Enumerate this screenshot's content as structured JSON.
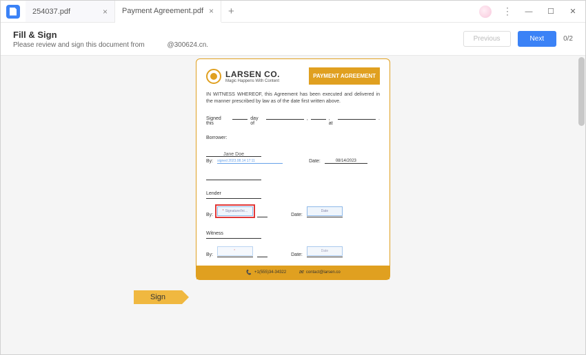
{
  "tabs": [
    {
      "label": "254037.pdf"
    },
    {
      "label": "Payment Agreement.pdf"
    }
  ],
  "subheader": {
    "title": "Fill & Sign",
    "instruction": "Please review and sign this document from",
    "sender": "@300624.cn.",
    "prev_label": "Previous",
    "next_label": "Next",
    "page_counter": "0/2"
  },
  "pointer": {
    "label": "Sign"
  },
  "document": {
    "company_name": "LARSEN CO.",
    "company_tagline": "Magic Happens With Content",
    "badge": "PAYMENT AGREEMENT",
    "witness": "IN WITNESS WHEREOF, this Agreement has been executed and delivered in the manner prescribed by law as of the date first written above.",
    "signed_this": "Signed this",
    "day_of": "day of",
    "at": ", at",
    "borrower_label": "Borrower:",
    "borrower_name": "Jane Doe",
    "borrower_sig": "signed 2023.08.14 17:11",
    "by_label": "By:",
    "date_label": "Date:",
    "date_value": "08/14/2023",
    "lender_label": "Lender",
    "sig_placeholder": "Signature/Ini…",
    "date_placeholder": "Date",
    "witness_label": "Witness",
    "phone": "+1(555)34-34322",
    "email": "contact@larsen.co"
  }
}
